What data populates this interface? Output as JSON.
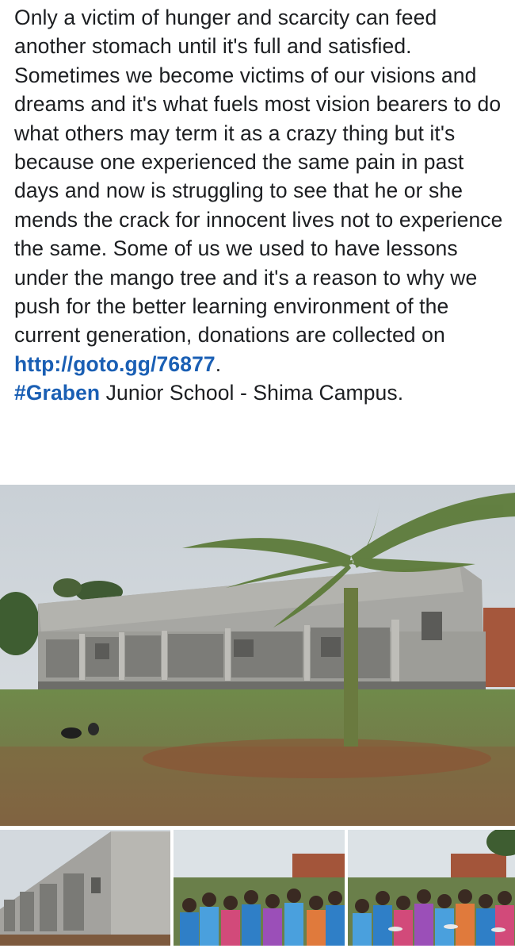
{
  "post": {
    "body": "Only a victim of hunger and scarcity can feed another stomach until it's  full and satisfied. Sometimes we become victims of our visions and dreams and it's what fuels most vision bearers to do what others may term it as a crazy thing but it's because one experienced the same pain in past days and now  is struggling to see that he or she mends the crack for innocent lives not to experience the same. Some of us we used to have lessons under the mango tree and it's a reason to why we push for the better learning environment of the current generation, donations are collected on ",
    "link_text": "http://goto.gg/76877",
    "after_link": ".",
    "hashtag": "#Graben",
    "hashtag_rest": " Junior School - Shima Campus."
  },
  "colors": {
    "text": "#1c1e21",
    "link": "#1a5fb4",
    "background": "#ffffff"
  },
  "photos": [
    {
      "name": "school-building-with-banana-tree"
    },
    {
      "name": "school-building-side-view"
    },
    {
      "name": "pupils-in-blue-uniforms"
    },
    {
      "name": "pupils-queue-with-plates"
    }
  ]
}
